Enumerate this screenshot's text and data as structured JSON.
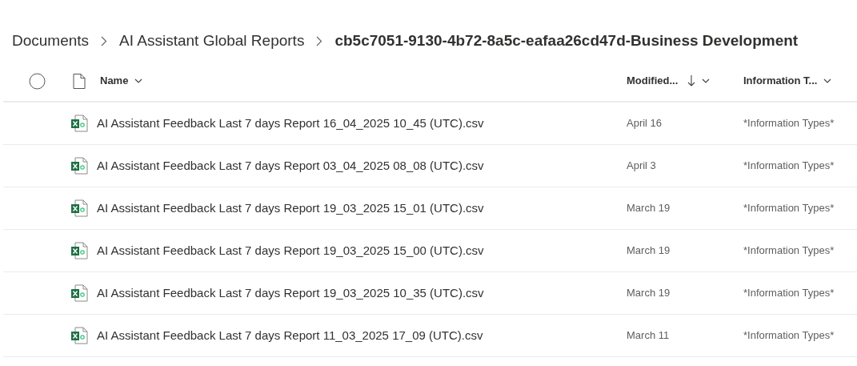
{
  "breadcrumb": [
    {
      "label": "Documents",
      "selected": false
    },
    {
      "label": "AI Assistant Global Reports",
      "selected": false
    },
    {
      "label": "cb5c7051-9130-4b72-8a5c-eafaa26cd47d-Business Development",
      "selected": true
    }
  ],
  "table": {
    "columns": [
      {
        "label": "Name",
        "sorted": false
      },
      {
        "label": "Modified...",
        "sorted": true
      },
      {
        "label": "Information T...",
        "sorted": false
      }
    ],
    "rows": [
      {
        "name": "AI Assistant Feedback Last 7 days Report 16_04_2025 10_45 (UTC).csv",
        "modified": "April 16",
        "information_types": "*Information Types*"
      },
      {
        "name": "AI Assistant Feedback Last 7 days Report 03_04_2025 08_08 (UTC).csv",
        "modified": "April 3",
        "information_types": "*Information Types*"
      },
      {
        "name": "AI Assistant Feedback Last 7 days Report 19_03_2025 15_01 (UTC).csv",
        "modified": "March 19",
        "information_types": "*Information Types*"
      },
      {
        "name": "AI Assistant Feedback Last 7 days Report 19_03_2025 15_00 (UTC).csv",
        "modified": "March 19",
        "information_types": "*Information Types*"
      },
      {
        "name": "AI Assistant Feedback Last 7 days Report 19_03_2025 10_35 (UTC).csv",
        "modified": "March 19",
        "information_types": "*Information Types*"
      },
      {
        "name": "AI Assistant Feedback Last 7 days Report 11_03_2025 17_09 (UTC).csv",
        "modified": "March 11",
        "information_types": "*Information Types*"
      }
    ]
  }
}
